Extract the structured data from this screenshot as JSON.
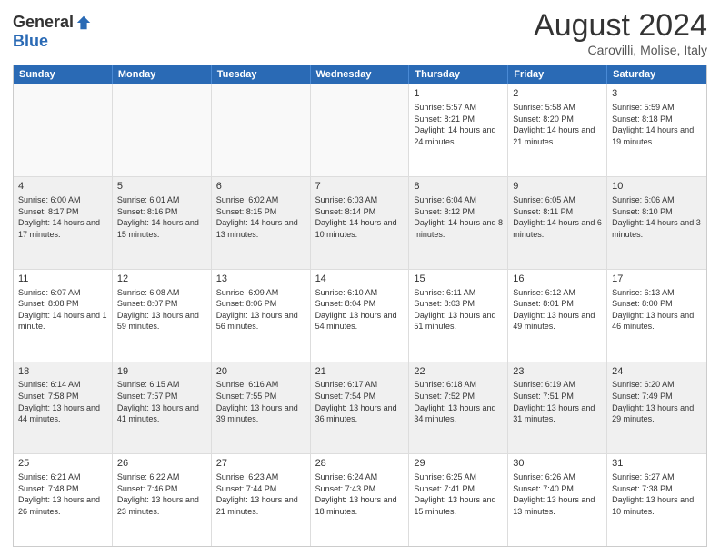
{
  "logo": {
    "general": "General",
    "blue": "Blue"
  },
  "title": "August 2024",
  "subtitle": "Carovilli, Molise, Italy",
  "header_days": [
    "Sunday",
    "Monday",
    "Tuesday",
    "Wednesday",
    "Thursday",
    "Friday",
    "Saturday"
  ],
  "weeks": [
    [
      {
        "day": "",
        "info": ""
      },
      {
        "day": "",
        "info": ""
      },
      {
        "day": "",
        "info": ""
      },
      {
        "day": "",
        "info": ""
      },
      {
        "day": "1",
        "info": "Sunrise: 5:57 AM\nSunset: 8:21 PM\nDaylight: 14 hours and 24 minutes."
      },
      {
        "day": "2",
        "info": "Sunrise: 5:58 AM\nSunset: 8:20 PM\nDaylight: 14 hours and 21 minutes."
      },
      {
        "day": "3",
        "info": "Sunrise: 5:59 AM\nSunset: 8:18 PM\nDaylight: 14 hours and 19 minutes."
      }
    ],
    [
      {
        "day": "4",
        "info": "Sunrise: 6:00 AM\nSunset: 8:17 PM\nDaylight: 14 hours and 17 minutes."
      },
      {
        "day": "5",
        "info": "Sunrise: 6:01 AM\nSunset: 8:16 PM\nDaylight: 14 hours and 15 minutes."
      },
      {
        "day": "6",
        "info": "Sunrise: 6:02 AM\nSunset: 8:15 PM\nDaylight: 14 hours and 13 minutes."
      },
      {
        "day": "7",
        "info": "Sunrise: 6:03 AM\nSunset: 8:14 PM\nDaylight: 14 hours and 10 minutes."
      },
      {
        "day": "8",
        "info": "Sunrise: 6:04 AM\nSunset: 8:12 PM\nDaylight: 14 hours and 8 minutes."
      },
      {
        "day": "9",
        "info": "Sunrise: 6:05 AM\nSunset: 8:11 PM\nDaylight: 14 hours and 6 minutes."
      },
      {
        "day": "10",
        "info": "Sunrise: 6:06 AM\nSunset: 8:10 PM\nDaylight: 14 hours and 3 minutes."
      }
    ],
    [
      {
        "day": "11",
        "info": "Sunrise: 6:07 AM\nSunset: 8:08 PM\nDaylight: 14 hours and 1 minute."
      },
      {
        "day": "12",
        "info": "Sunrise: 6:08 AM\nSunset: 8:07 PM\nDaylight: 13 hours and 59 minutes."
      },
      {
        "day": "13",
        "info": "Sunrise: 6:09 AM\nSunset: 8:06 PM\nDaylight: 13 hours and 56 minutes."
      },
      {
        "day": "14",
        "info": "Sunrise: 6:10 AM\nSunset: 8:04 PM\nDaylight: 13 hours and 54 minutes."
      },
      {
        "day": "15",
        "info": "Sunrise: 6:11 AM\nSunset: 8:03 PM\nDaylight: 13 hours and 51 minutes."
      },
      {
        "day": "16",
        "info": "Sunrise: 6:12 AM\nSunset: 8:01 PM\nDaylight: 13 hours and 49 minutes."
      },
      {
        "day": "17",
        "info": "Sunrise: 6:13 AM\nSunset: 8:00 PM\nDaylight: 13 hours and 46 minutes."
      }
    ],
    [
      {
        "day": "18",
        "info": "Sunrise: 6:14 AM\nSunset: 7:58 PM\nDaylight: 13 hours and 44 minutes."
      },
      {
        "day": "19",
        "info": "Sunrise: 6:15 AM\nSunset: 7:57 PM\nDaylight: 13 hours and 41 minutes."
      },
      {
        "day": "20",
        "info": "Sunrise: 6:16 AM\nSunset: 7:55 PM\nDaylight: 13 hours and 39 minutes."
      },
      {
        "day": "21",
        "info": "Sunrise: 6:17 AM\nSunset: 7:54 PM\nDaylight: 13 hours and 36 minutes."
      },
      {
        "day": "22",
        "info": "Sunrise: 6:18 AM\nSunset: 7:52 PM\nDaylight: 13 hours and 34 minutes."
      },
      {
        "day": "23",
        "info": "Sunrise: 6:19 AM\nSunset: 7:51 PM\nDaylight: 13 hours and 31 minutes."
      },
      {
        "day": "24",
        "info": "Sunrise: 6:20 AM\nSunset: 7:49 PM\nDaylight: 13 hours and 29 minutes."
      }
    ],
    [
      {
        "day": "25",
        "info": "Sunrise: 6:21 AM\nSunset: 7:48 PM\nDaylight: 13 hours and 26 minutes."
      },
      {
        "day": "26",
        "info": "Sunrise: 6:22 AM\nSunset: 7:46 PM\nDaylight: 13 hours and 23 minutes."
      },
      {
        "day": "27",
        "info": "Sunrise: 6:23 AM\nSunset: 7:44 PM\nDaylight: 13 hours and 21 minutes."
      },
      {
        "day": "28",
        "info": "Sunrise: 6:24 AM\nSunset: 7:43 PM\nDaylight: 13 hours and 18 minutes."
      },
      {
        "day": "29",
        "info": "Sunrise: 6:25 AM\nSunset: 7:41 PM\nDaylight: 13 hours and 15 minutes."
      },
      {
        "day": "30",
        "info": "Sunrise: 6:26 AM\nSunset: 7:40 PM\nDaylight: 13 hours and 13 minutes."
      },
      {
        "day": "31",
        "info": "Sunrise: 6:27 AM\nSunset: 7:38 PM\nDaylight: 13 hours and 10 minutes."
      }
    ]
  ]
}
